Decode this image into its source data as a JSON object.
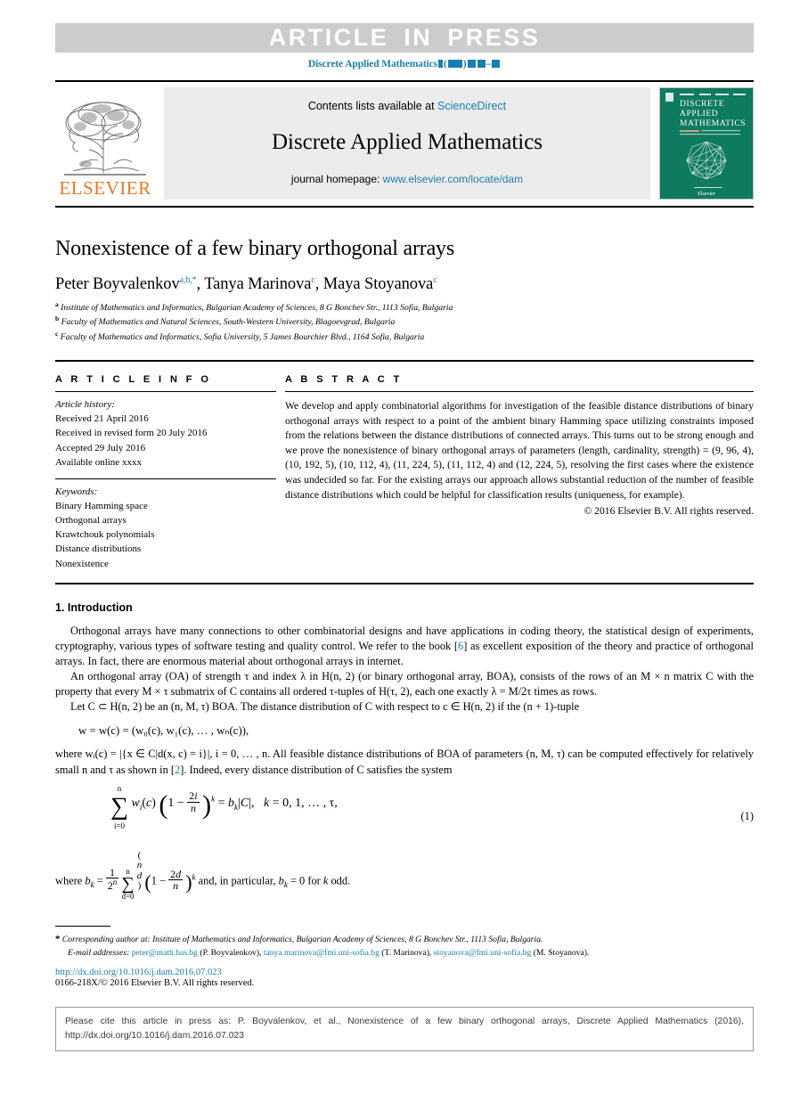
{
  "banner": {
    "text": "ARTICLE IN PRESS",
    "running_head_journal": "Discrete Applied Mathematics",
    "running_head_suffix_open": "(",
    "running_head_suffix_close": ")",
    "running_head_dash": "–"
  },
  "masthead": {
    "publisher_wordmark": "ELSEVIER",
    "contents_prefix": "Contents lists available at ",
    "contents_link": "ScienceDirect",
    "journal_title": "Discrete Applied Mathematics",
    "homepage_prefix": "journal homepage: ",
    "homepage_link": "www.elsevier.com/locate/dam",
    "cover": {
      "line1": "DISCRETE",
      "line2": "APPLIED",
      "line3": "MATHEMATICS",
      "footer": "Elsevier",
      "bg_color": "#0e7a5f"
    }
  },
  "article": {
    "title": "Nonexistence of a few binary orthogonal arrays",
    "authors": [
      {
        "name": "Peter Boyvalenkov",
        "marks": "a,b,",
        "star": "*"
      },
      {
        "name": "Tanya Marinova",
        "marks": "c",
        "star": ""
      },
      {
        "name": "Maya Stoyanova",
        "marks": "c",
        "star": ""
      }
    ],
    "affiliations": [
      {
        "mark": "a",
        "text": "Institute of Mathematics and Informatics, Bulgarian Academy of Sciences, 8 G Bonchev Str., 1113 Sofia, Bulgaria"
      },
      {
        "mark": "b",
        "text": "Faculty of Mathematics and Natural Sciences, South-Western University, Blagoevgrad, Bulgaria"
      },
      {
        "mark": "c",
        "text": "Faculty of Mathematics and Informatics, Sofia University, 5 James Bourchier Blvd., 1164 Sofia, Bulgaria"
      }
    ]
  },
  "info": {
    "label": "A R T I C L E  I N F O",
    "history_label": "Article history:",
    "history": [
      "Received 21 April 2016",
      "Received in revised form 20 July 2016",
      "Accepted 29 July 2016",
      "Available online xxxx"
    ],
    "keywords_label": "Keywords:",
    "keywords": [
      "Binary Hamming space",
      "Orthogonal arrays",
      "Krawtchouk polynomials",
      "Distance distributions",
      "Nonexistence"
    ]
  },
  "abstract": {
    "label": "A B S T R A C T",
    "text": "We develop and apply combinatorial algorithms for investigation of the feasible distance distributions of binary orthogonal arrays with respect to a point of the ambient binary Hamming space utilizing constraints imposed from the relations between the distance distributions of connected arrays. This turns out to be strong enough and we prove the nonexistence of binary orthogonal arrays of parameters (length, cardinality, strength) = (9, 96, 4), (10, 192, 5), (10, 112, 4), (11, 224, 5), (11, 112, 4) and (12, 224, 5), resolving the first cases where the existence was undecided so far. For the existing arrays our approach allows substantial reduction of the number of feasible distance distributions which could be helpful for classification results (uniqueness, for example).",
    "copyright": "© 2016 Elsevier B.V. All rights reserved."
  },
  "body": {
    "section_heading": "1. Introduction",
    "para1_a": "Orthogonal arrays have many connections to other combinatorial designs and have applications in coding theory, the statistical design of experiments, cryptography, various types of software testing and quality control. We refer to the book [",
    "para1_ref": "6",
    "para1_b": "] as excellent exposition of the theory and practice of orthogonal arrays. In fact, there are enormous material about orthogonal arrays in internet.",
    "para2": "An orthogonal array (OA) of strength τ and index λ in H(n, 2) (or binary orthogonal array, BOA), consists of the rows of an M × n matrix C with the property that every M × τ submatrix of C contains all ordered τ-tuples of H(τ, 2), each one exactly λ = M/2τ times as rows.",
    "para3": "Let C ⊂ H(n, 2) be an (n, M, τ) BOA. The distance distribution of C with respect to c ∈ H(n, 2) if the (n + 1)-tuple",
    "display_w": "w = w(c) = (w₀(c), w₁(c), … , wₙ(c)),",
    "para4_a": "where wᵢ(c) = |{x ∈ C|d(x, c) = i}|, i = 0, … , n. All feasible distance distributions of BOA of parameters (n, M, τ) can be computed effectively for relatively small n and τ as shown in [",
    "para4_ref": "2",
    "para4_b": "]. Indeed, every distance distribution of C satisfies the system",
    "equation_number": "(1)",
    "where_bk": "and, in particular,",
    "where_bk_tail": "for k odd."
  },
  "footnote": {
    "star": "*",
    "corresponding": "Corresponding author at: Institute of Mathematics and Informatics, Bulgarian Academy of Sciences, 8 G Bonchev Str., 1113 Sofia, Bulgaria.",
    "email_label": "E-mail addresses:",
    "emails": [
      {
        "address": "peter@math.bas.bg",
        "owner": "(P. Boyvalenkov),"
      },
      {
        "address": "tanya.marinova@fmi.uni-sofia.bg",
        "owner": "(T. Marinova),"
      },
      {
        "address": "stoyanova@fmi.uni-sofia.bg",
        "owner": "(M. Stoyanova)."
      }
    ],
    "doi": "http://dx.doi.org/10.1016/j.dam.2016.07.023",
    "issn": "0166-218X/© 2016 Elsevier B.V. All rights reserved."
  },
  "cite_box": {
    "text": "Please cite this article in press as: P. Boyvalenkov, et al., Nonexistence of a few binary orthogonal arrays, Discrete Applied Mathematics (2016), http://dx.doi.org/10.1016/j.dam.2016.07.023"
  },
  "colors": {
    "link": "#1a7eb0",
    "banner_bg": "#cccccc",
    "band_bg": "#ececec",
    "elsevier_orange": "#e87722",
    "cover_green": "#0e7a5f"
  }
}
